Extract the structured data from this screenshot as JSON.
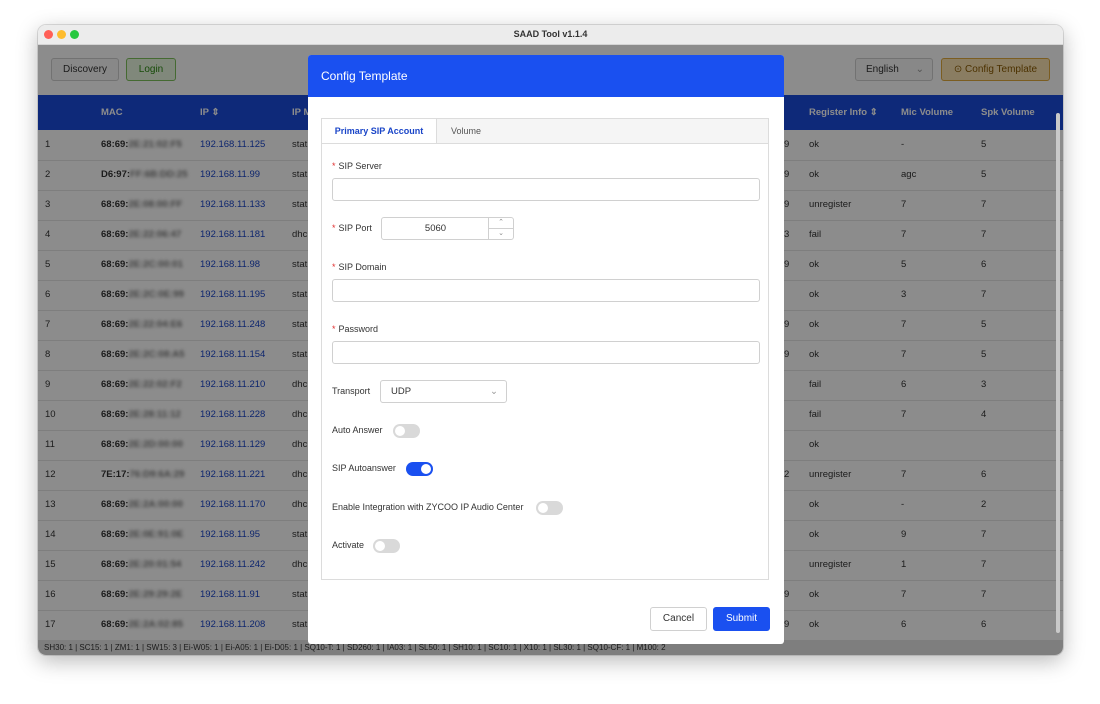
{
  "window": {
    "title": "SAAD Tool v1.1.4"
  },
  "toolbar": {
    "discovery_label": "Discovery",
    "login_label": "Login",
    "language": "English",
    "config_template_label": "Config Template"
  },
  "table": {
    "headers": {
      "mac": "MAC",
      "ip": "IP ⇕",
      "ip_mode": "IP M",
      "register_info": "Register Info ⇕",
      "mic_volume": "Mic Volume",
      "spk_volume": "Spk Volume"
    },
    "rows": [
      {
        "idx": "1",
        "mac_a": "68:69:",
        "mac_b": "2E:21:02:F5",
        "ip": "192.168.11.125",
        "mode": "stat",
        "ext": "9",
        "reg": "ok",
        "mic": "-",
        "spk": "5"
      },
      {
        "idx": "2",
        "mac_a": "D6:97:",
        "mac_b": "FF:6B:DD:25",
        "ip": "192.168.11.99",
        "mode": "stat",
        "ext": "9",
        "reg": "ok",
        "mic": "agc",
        "spk": "5"
      },
      {
        "idx": "3",
        "mac_a": "68:69:",
        "mac_b": "2E:08:00:FF",
        "ip": "192.168.11.133",
        "mode": "stat",
        "ext": "9",
        "reg": "unregister",
        "mic": "7",
        "spk": "7"
      },
      {
        "idx": "4",
        "mac_a": "68:69:",
        "mac_b": "2E:22:06:47",
        "ip": "192.168.11.181",
        "mode": "dhc",
        "ext": "3",
        "reg": "fail",
        "mic": "7",
        "spk": "7"
      },
      {
        "idx": "5",
        "mac_a": "68:69:",
        "mac_b": "2E:2C:00:01",
        "ip": "192.168.11.98",
        "mode": "stat",
        "ext": "9",
        "reg": "ok",
        "mic": "5",
        "spk": "6"
      },
      {
        "idx": "6",
        "mac_a": "68:69:",
        "mac_b": "2E:2C:0E:99",
        "ip": "192.168.11.195",
        "mode": "stat",
        "ext": "",
        "reg": "ok",
        "mic": "3",
        "spk": "7"
      },
      {
        "idx": "7",
        "mac_a": "68:69:",
        "mac_b": "2E:22:04:E6",
        "ip": "192.168.11.248",
        "mode": "stat",
        "ext": "9",
        "reg": "ok",
        "mic": "7",
        "spk": "5"
      },
      {
        "idx": "8",
        "mac_a": "68:69:",
        "mac_b": "2E:2C:08:A5",
        "ip": "192.168.11.154",
        "mode": "stat",
        "ext": "9",
        "reg": "ok",
        "mic": "7",
        "spk": "5"
      },
      {
        "idx": "9",
        "mac_a": "68:69:",
        "mac_b": "2E:22:02:F2",
        "ip": "192.168.11.210",
        "mode": "dhc",
        "ext": "",
        "reg": "fail",
        "mic": "6",
        "spk": "3"
      },
      {
        "idx": "10",
        "mac_a": "68:69:",
        "mac_b": "2E:28:11:12",
        "ip": "192.168.11.228",
        "mode": "dhc",
        "ext": "",
        "reg": "fail",
        "mic": "7",
        "spk": "4"
      },
      {
        "idx": "11",
        "mac_a": "68:69:",
        "mac_b": "2E:2D:00:00",
        "ip": "192.168.11.129",
        "mode": "dhc",
        "ext": "",
        "reg": "ok",
        "mic": "",
        "spk": ""
      },
      {
        "idx": "12",
        "mac_a": "7E:17:",
        "mac_b": "76:D9:6A:29",
        "ip": "192.168.11.221",
        "mode": "dhc",
        "ext": "2",
        "reg": "unregister",
        "mic": "7",
        "spk": "6"
      },
      {
        "idx": "13",
        "mac_a": "68:69:",
        "mac_b": "2E:2A:00:00",
        "ip": "192.168.11.170",
        "mode": "dhc",
        "ext": "",
        "reg": "ok",
        "mic": "-",
        "spk": "2"
      },
      {
        "idx": "14",
        "mac_a": "68:69:",
        "mac_b": "2E:0E:91:0E",
        "ip": "192.168.11.95",
        "mode": "stat",
        "ext": "",
        "reg": "ok",
        "mic": "9",
        "spk": "7"
      },
      {
        "idx": "15",
        "mac_a": "68:69:",
        "mac_b": "2E:20:01:54",
        "ip": "192.168.11.242",
        "mode": "dhc",
        "ext": "",
        "reg": "unregister",
        "mic": "1",
        "spk": "7"
      },
      {
        "idx": "16",
        "mac_a": "68:69:",
        "mac_b": "2E:29:29:2E",
        "ip": "192.168.11.91",
        "mode": "stat",
        "ext": "9",
        "reg": "ok",
        "mic": "7",
        "spk": "7"
      },
      {
        "idx": "17",
        "mac_a": "68:69:",
        "mac_b": "2E:2A:02:85",
        "ip": "192.168.11.208",
        "mode": "stat",
        "ext": "9",
        "reg": "ok",
        "mic": "6",
        "spk": "6"
      }
    ]
  },
  "status_bar": "SH30: 1 | SC15: 1 | ZM1: 1 | SW15: 3 | Ei-W05: 1 | Ei-A05: 1 | Ei-D05: 1 | SQ10-T: 1 | SD260: 1 | IA03: 1 | SL50: 1 | SH10: 1 | SC10: 1 | X10: 1 | SL30: 1 | SQ10-CF: 1 | M100: 2",
  "modal": {
    "title": "Config Template",
    "tabs": [
      "Primary SIP Account",
      "Volume"
    ],
    "required_mark": "*",
    "sip_server_label": "SIP Server",
    "sip_server_value": "",
    "sip_port_label": "SIP Port",
    "sip_port_value": "5060",
    "sip_domain_label": "SIP Domain",
    "sip_domain_value": "",
    "password_label": "Password",
    "password_value": "",
    "transport_label": "Transport",
    "transport_value": "UDP",
    "auto_answer_label": "Auto Answer",
    "auto_answer_on": false,
    "sip_autoanswer_label": "SIP Autoanswer",
    "sip_autoanswer_on": true,
    "integration_label": "Enable Integration with ZYCOO IP Audio Center",
    "integration_on": false,
    "activate_label": "Activate",
    "activate_on": false,
    "cancel_label": "Cancel",
    "submit_label": "Submit"
  },
  "colors": {
    "accent": "#1a50f0",
    "table_header": "#1a4bdc",
    "config_template_button": "#d08a00",
    "login_button": "#52c41a",
    "required": "#e03030"
  },
  "icons": {
    "config_template": "settings-circle-icon",
    "language_dropdown": "chevron-down-icon",
    "sort": "sort-icon"
  }
}
